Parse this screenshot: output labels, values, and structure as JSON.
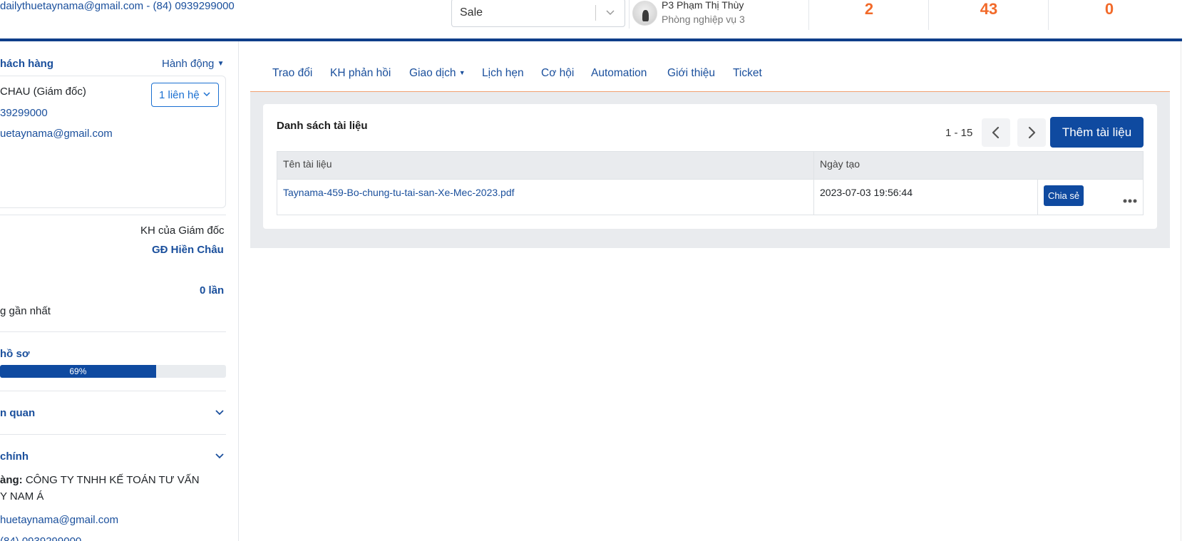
{
  "header": {
    "contact_line": "dailythuetaynama@gmail.com - (84) 0939299000",
    "stage_select_value": "Sale",
    "staff_name": "P3 Phạm Thị Thùy",
    "staff_dept": "Phòng nghiệp vụ 3",
    "stats": [
      "2",
      "43",
      "0"
    ]
  },
  "sidebar": {
    "section_customer": "hách hàng",
    "actions_label": "Hành động",
    "contact_name": "CHAU (Giám đốc)",
    "contact_phone": "39299000",
    "contact_email": "uetaynama@gmail.com",
    "contacts_button": "1 liên hệ",
    "owner_label": "KH của Giám đốc",
    "owner_value": "GĐ Hiền Châu",
    "count_value": "0 lần",
    "recent_label": "g gần nhất",
    "profile_section": "hồ sơ",
    "profile_progress_label": "69%",
    "profile_progress": 0.69,
    "related_section": "n quan",
    "main_section": "chính",
    "company_label": "àng:",
    "company_value_1": "CÔNG TY TNHH KẾ TOÁN TƯ VẤN",
    "company_value_2": "Y NAM Á",
    "company_email": "huetaynama@gmail.com",
    "company_phone_partial": "(84) 0939299000"
  },
  "tabs": [
    "Trao đổi",
    "KH phản hồi",
    "Giao dịch",
    "Lịch hẹn",
    "Cơ hội",
    "Automation",
    "Giới thiệu",
    "Ticket"
  ],
  "documents": {
    "title": "Danh sách tài liệu",
    "pager": "1 - 15",
    "add_button": "Thêm tài liệu",
    "columns": [
      "Tên tài liệu",
      "Ngày tạo"
    ],
    "rows": [
      {
        "name": "Taynama-459-Bo-chung-tu-tai-san-Xe-Mec-2023.pdf",
        "created": "2023-07-03 19:56:44",
        "share_label": "Chia sẻ"
      }
    ]
  },
  "colors": {
    "brand_blue": "#0f4aa0",
    "link_blue": "#1a4f9c",
    "accent_orange": "#f26a2a"
  },
  "icons": [
    "chevron-down-icon",
    "chevron-left-icon",
    "chevron-right-icon",
    "more-horizontal-icon",
    "caret-down-icon"
  ]
}
